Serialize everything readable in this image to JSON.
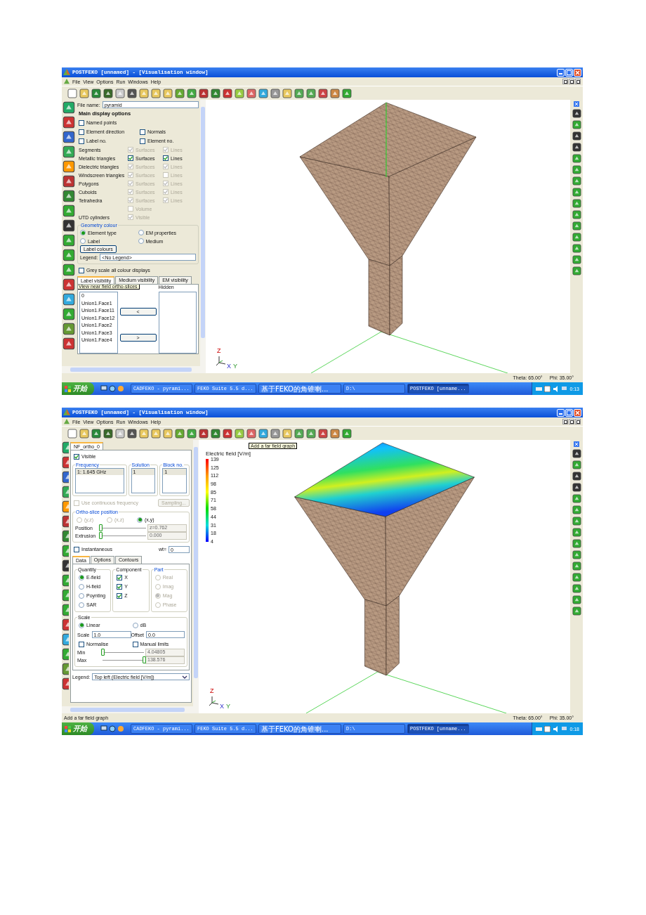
{
  "screens": [
    {
      "window": {
        "title": "POSTFEKO [unnamed] - [Visualisation window]"
      },
      "menu": [
        "File",
        "View",
        "Options",
        "Run",
        "Windows",
        "Help"
      ],
      "panel": {
        "kind": "display",
        "file_name": {
          "label": "File name:",
          "value": "pyramid"
        },
        "heading": "Main display options",
        "options": [
          [
            {
              "label": "Named points",
              "checked": false
            }
          ],
          [
            {
              "label": "Element direction",
              "checked": false
            },
            {
              "label": "Normals",
              "checked": false
            }
          ],
          [
            {
              "label": "Label no.",
              "checked": false
            },
            {
              "label": "Element no.",
              "checked": false
            }
          ]
        ],
        "elements": [
          {
            "label": "Segments",
            "cells": [
              {
                "label": "Surfaces",
                "checked": true,
                "disabled": true
              },
              {
                "label": "Lines",
                "checked": true,
                "disabled": true
              }
            ]
          },
          {
            "label": "Metallic triangles",
            "cells": [
              {
                "label": "Surfaces",
                "checked": true,
                "disabled": false
              },
              {
                "label": "Lines",
                "checked": true,
                "disabled": false
              }
            ]
          },
          {
            "label": "Dielectric triangles",
            "cells": [
              {
                "label": "Surfaces",
                "checked": true,
                "disabled": true
              },
              {
                "label": "Lines",
                "checked": true,
                "disabled": true
              }
            ]
          },
          {
            "label": "Windscreen triangles",
            "cells": [
              {
                "label": "Surfaces",
                "checked": true,
                "disabled": true
              },
              {
                "label": "Lines",
                "checked": false,
                "disabled": true
              }
            ]
          },
          {
            "label": "Polygons",
            "cells": [
              {
                "label": "Surfaces",
                "checked": true,
                "disabled": true
              },
              {
                "label": "Lines",
                "checked": true,
                "disabled": true
              }
            ]
          },
          {
            "label": "Cuboids",
            "cells": [
              {
                "label": "Surfaces",
                "checked": true,
                "disabled": true
              },
              {
                "label": "Lines",
                "checked": true,
                "disabled": true
              }
            ]
          },
          {
            "label": "Tetrahedra",
            "cells": [
              {
                "label": "Surfaces",
                "checked": true,
                "disabled": true
              },
              {
                "label": "Lines",
                "checked": true,
                "disabled": true
              }
            ]
          },
          {
            "cells": [
              {
                "label": "Volume",
                "checked": false,
                "disabled": true
              }
            ]
          },
          {
            "label": "UTD cylinders",
            "cells": [
              {
                "label": "Visible",
                "checked": true,
                "disabled": true
              }
            ]
          }
        ],
        "geometry_colour": {
          "title": "Geometry colour",
          "options": [
            {
              "label": "Element type",
              "selected": true
            },
            {
              "label": "EM properties",
              "selected": false
            },
            {
              "label": "Label",
              "selected": false
            },
            {
              "label": "Medium",
              "selected": false
            }
          ],
          "button": "Label colours",
          "legend": {
            "label": "Legend:",
            "value": "<No Legend>"
          }
        },
        "grey_scale": {
          "label": "Grey scale all colour displays",
          "checked": false
        },
        "tabs": [
          {
            "label": "Label visibility",
            "selected": true
          },
          {
            "label": "Medium visibility",
            "selected": false
          },
          {
            "label": "EM visibility",
            "selected": false
          }
        ],
        "hidden_header": "Hidden",
        "visible_items": [
          "0",
          "Union1.Face1",
          "Union1.Face11",
          "Union1.Face12",
          "Union1.Face2",
          "Union1.Face3",
          "Union1.Face4"
        ],
        "move_buttons": [
          "<",
          ">"
        ]
      },
      "tooltip": {
        "kind": "side",
        "text": "View near field ortho-slices"
      },
      "viewport": {
        "kind": "mesh"
      },
      "axes": [
        "Z",
        "X",
        "Y"
      ],
      "status_bar": {
        "theta": "Theta: 65.00°",
        "phi": "Phi: 35.00°"
      },
      "taskbar": {
        "start": "开始",
        "tasks": [
          {
            "label": "CADFEKO - pyrami...",
            "selected": false
          },
          {
            "label": "FEKO Suite 5.5 d...",
            "selected": false
          },
          {
            "label": "基于FEKO的角锥喇...",
            "selected": false
          },
          {
            "label": "D:\\",
            "selected": false
          },
          {
            "label": "POSTFEKO [unname...",
            "selected": true
          }
        ],
        "clock": "0:13"
      }
    },
    {
      "window": {
        "title": "POSTFEKO [unnamed] - [Visualisation window]"
      },
      "menu": [
        "File",
        "View",
        "Options",
        "Run",
        "Windows",
        "Help"
      ],
      "panel": {
        "kind": "ortho",
        "tab": "NF_ortho_0",
        "visible": {
          "label": "Visible",
          "checked": true
        },
        "columns": [
          {
            "title": "Frequency",
            "value": "1: 1.645 GHz"
          },
          {
            "title": "Solution",
            "value": "1"
          },
          {
            "title": "Block no.",
            "value": "1"
          }
        ],
        "continuous": {
          "label": "Use continuous frequency",
          "checked": false,
          "disabled": true
        },
        "sampling": {
          "label": "Sampling...",
          "disabled": true
        },
        "ortho": {
          "title": "Ortho-slice position",
          "planes": [
            {
              "label": "(y,z)",
              "selected": false,
              "disabled": true
            },
            {
              "label": "(x,z)",
              "selected": false,
              "disabled": true
            },
            {
              "label": "(x,y)",
              "selected": true,
              "disabled": false
            }
          ],
          "sliders": [
            {
              "label": "Position",
              "level": 0,
              "value": "z=0.762"
            },
            {
              "label": "Extrusion",
              "level": 0,
              "value": "0.000"
            }
          ]
        },
        "instantaneous": {
          "label": "Instantaneous",
          "checked": false
        },
        "wt": {
          "label": "wt=",
          "value": "0"
        },
        "tabs": [
          {
            "label": "Data",
            "selected": true
          },
          {
            "label": "Options",
            "selected": false
          },
          {
            "label": "Contours",
            "selected": false
          }
        ],
        "quantity": {
          "title": "Quantity",
          "options": [
            {
              "label": "E-field",
              "selected": true
            },
            {
              "label": "H-field",
              "selected": false
            },
            {
              "label": "Poynting",
              "selected": false
            },
            {
              "label": "SAR",
              "selected": false
            }
          ]
        },
        "component": {
          "title": "Component",
          "options": [
            {
              "label": "X",
              "checked": true
            },
            {
              "label": "Y",
              "checked": true
            },
            {
              "label": "Z",
              "checked": true
            }
          ]
        },
        "part": {
          "title": "Part",
          "options": [
            {
              "label": "Real",
              "selected": false,
              "disabled": true
            },
            {
              "label": "Imag",
              "selected": false,
              "disabled": true
            },
            {
              "label": "Mag",
              "selected": true,
              "disabled": true
            },
            {
              "label": "Phase",
              "selected": false,
              "disabled": true
            }
          ]
        },
        "scale": {
          "title": "Scale",
          "modes": [
            {
              "label": "Linear",
              "selected": true
            },
            {
              "label": "dB",
              "selected": false
            }
          ],
          "fields": [
            {
              "label": "Scale",
              "value": "1.0"
            },
            {
              "label": "Offset",
              "value": "0.0"
            }
          ],
          "checks": [
            {
              "label": "Normalise",
              "checked": false
            },
            {
              "label": "Manual limits",
              "checked": false
            }
          ],
          "sliders": [
            {
              "label": "Min",
              "level": 0,
              "value": "4.04805"
            },
            {
              "label": "Max",
              "level": 1,
              "value": "138.576"
            }
          ]
        },
        "legend": {
          "label": "Legend:",
          "value": "Top left (Electric field [V/m])"
        }
      },
      "tooltip": {
        "kind": "toolbar",
        "text": "Add a far field graph"
      },
      "viewport": {
        "kind": "field",
        "legend": {
          "title": "Electric field [V/m]",
          "ticks": [
            "139",
            "125",
            "112",
            "98",
            "85",
            "71",
            "58",
            "44",
            "31",
            "18",
            "4"
          ]
        }
      },
      "axes": [
        "Z",
        "X",
        "Y"
      ],
      "status_bar": {
        "message": "Add a far field graph",
        "theta": "Theta: 65.00°",
        "phi": "Phi: 35.00°"
      },
      "taskbar": {
        "start": "开始",
        "tasks": [
          {
            "label": "CADFEKO - pyrami...",
            "selected": false
          },
          {
            "label": "FEKO Suite 5.5 d...",
            "selected": false
          },
          {
            "label": "基于FEKO的角锥喇...",
            "selected": false
          },
          {
            "label": "D:\\",
            "selected": false
          },
          {
            "label": "POSTFEKO [unname...",
            "selected": true
          }
        ],
        "clock": "0:18"
      }
    }
  ]
}
